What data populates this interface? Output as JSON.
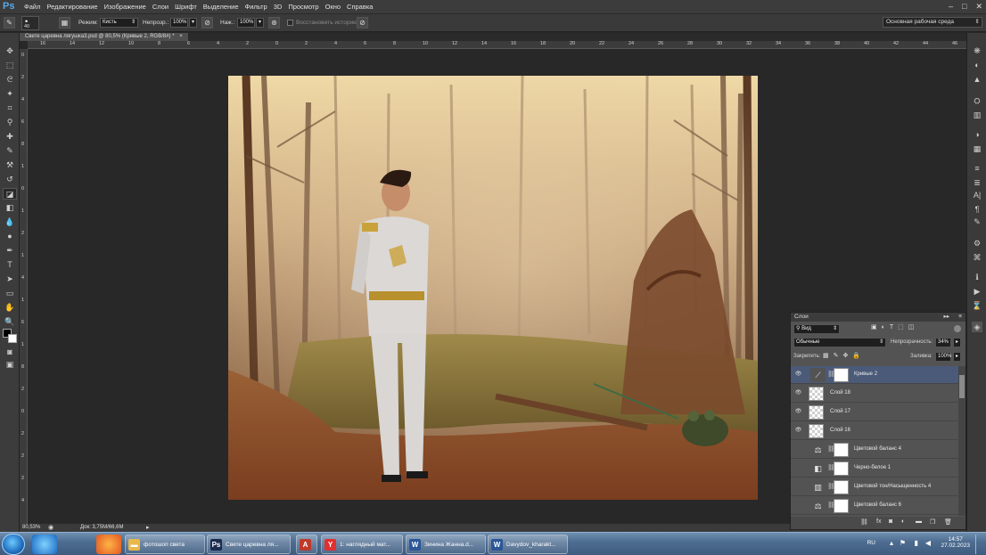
{
  "app": {
    "logo": "Ps"
  },
  "menu": [
    "Файл",
    "Редактирование",
    "Изображение",
    "Слои",
    "Шрифт",
    "Выделение",
    "Фильтр",
    "3D",
    "Просмотр",
    "Окно",
    "Справка"
  ],
  "window_controls": [
    "–",
    "□",
    "✕"
  ],
  "options": {
    "brush_size": "40",
    "mode_label": "Режим:",
    "mode_value": "Кисть",
    "opacity_label": "Непрозр.:",
    "opacity_value": "100%",
    "flow_label": "Наж.:",
    "flow_value": "100%",
    "history_label": "Восстановить историю",
    "workspace": "Основная рабочая среда"
  },
  "document": {
    "tab_title": "Свете царевна лягушка3.psd @ 80,5% (Кривые 2, RGB/8#) *"
  },
  "ruler_top": [
    "16",
    "14",
    "12",
    "10",
    "8",
    "6",
    "4",
    "2",
    "0",
    "2",
    "4",
    "6",
    "8",
    "10",
    "12",
    "14",
    "16",
    "18",
    "20",
    "22",
    "24",
    "26",
    "28",
    "30",
    "32",
    "34",
    "36",
    "38",
    "40",
    "42",
    "44",
    "46"
  ],
  "ruler_left": [
    "0",
    "2",
    "4",
    "6",
    "8",
    "1",
    "0",
    "1",
    "2",
    "1",
    "4",
    "1",
    "6",
    "1",
    "8",
    "2",
    "0",
    "2",
    "2",
    "2",
    "4"
  ],
  "status": {
    "zoom": "80,53%",
    "doc_info": "Док: 3,75M/66,6M"
  },
  "layers_panel": {
    "title": "Слои",
    "filter": "Вид",
    "blend_mode": "Обычные",
    "opacity_label": "Непрозрачность:",
    "opacity_value": "34%",
    "lock_label": "Закрепить:",
    "fill_label": "Заливка:",
    "fill_value": "100%",
    "layers": [
      {
        "name": "Кривые 2",
        "kind": "adjustment",
        "icon": "curves-icon",
        "visible": true,
        "selected": true
      },
      {
        "name": "Слой 18",
        "kind": "pixel",
        "visible": true,
        "selected": false
      },
      {
        "name": "Слой 17",
        "kind": "pixel",
        "visible": true,
        "selected": false
      },
      {
        "name": "Слой 16",
        "kind": "pixel",
        "visible": true,
        "selected": false
      },
      {
        "name": "Цветовой баланс 4",
        "kind": "adjustment",
        "icon": "balance-icon",
        "visible": false,
        "selected": false
      },
      {
        "name": "Черно-белое 1",
        "kind": "adjustment",
        "icon": "bw-icon",
        "visible": false,
        "selected": false
      },
      {
        "name": "Цветовой тон/Насыщенность 4",
        "kind": "adjustment",
        "icon": "hue-icon",
        "visible": false,
        "selected": false
      },
      {
        "name": "Цветовой баланс 6",
        "kind": "adjustment",
        "icon": "balance-icon",
        "visible": false,
        "selected": false
      }
    ]
  },
  "taskbar": {
    "items": [
      {
        "label": "фотошоп света",
        "icon": "folder-icon",
        "color": "#e8b84a"
      },
      {
        "label": "Свете царевна ля...",
        "icon": "photoshop-icon",
        "color": "#1b2a4e"
      },
      {
        "label": "",
        "icon": "acrobat-icon",
        "color": "#c0392b"
      },
      {
        "label": "1: наглядный мат...",
        "icon": "yandex-icon",
        "color": "#e03030"
      },
      {
        "label": "Зинина Жанна.d...",
        "icon": "word-icon",
        "color": "#2b5797"
      },
      {
        "label": "Davydov_kharakt...",
        "icon": "word-icon",
        "color": "#2b5797"
      }
    ],
    "tray_lang": "RU",
    "time": "14:57",
    "date": "27.02.2023"
  }
}
